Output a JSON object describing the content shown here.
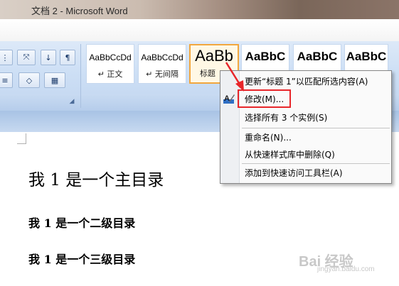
{
  "window": {
    "title": "文档 2 - Microsoft Word"
  },
  "ribbon": {
    "paragraph_buttons": [
      "shading-icon",
      "border-icon",
      "sort-icon",
      "show-marks-icon",
      "multilevel-list-icon",
      "text-direction-icon"
    ],
    "styles": [
      {
        "sample": "AaBbCcDd",
        "name": "↵ 正文"
      },
      {
        "sample": "AaBbCcDd",
        "name": "↵ 无间隔"
      },
      {
        "sample": "AaBb",
        "name": "标题"
      },
      {
        "sample": "AaBbC",
        "name": ""
      },
      {
        "sample": "AaBbC",
        "name": ""
      },
      {
        "sample": "AaBbC",
        "name": ""
      }
    ]
  },
  "context_menu": {
    "items": [
      "更新“标题 1”以匹配所选内容(A)",
      "修改(M)...",
      "选择所有 3 个实例(S)",
      "重命名(N)...",
      "从快速样式库中删除(Q)",
      "添加到快速访问工具栏(A)"
    ]
  },
  "document": {
    "heading1": "我 1 是一个主目录",
    "heading2": "我 1 是一个二级目录",
    "heading3": "我 1 是一个三级目录"
  },
  "watermark": {
    "text": "Bai 经验",
    "sub": "jingyan.baidu.com"
  },
  "colors": {
    "highlight": "#e8262a",
    "selected_style": "#f2a73e",
    "ribbon": "#cddff5"
  }
}
